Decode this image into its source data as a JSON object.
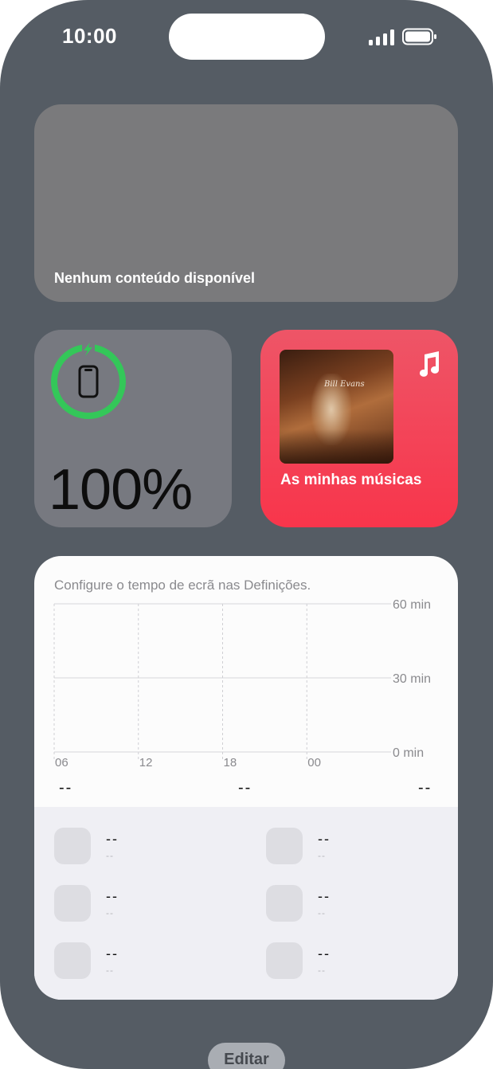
{
  "status_bar": {
    "time": "10:00"
  },
  "news_widget": {
    "message": "Nenhum conteúdo disponível"
  },
  "battery_widget": {
    "level_percent": 100,
    "label": "100%",
    "charging": true,
    "ring_color": "#34c759",
    "device_icon": "iphone-icon",
    "bolt_icon": "lightning-bolt-icon"
  },
  "music_widget": {
    "title": "As minhas músicas",
    "app_icon": "music-note-icon",
    "album_artist": "Bill Evans",
    "accent": "#f8354b"
  },
  "screen_time_widget": {
    "hint": "Configure o tempo de ecrã nas Definições.",
    "summary": [
      "--",
      "--",
      "--"
    ],
    "apps": [
      {
        "name": "--",
        "time": "--"
      },
      {
        "name": "--",
        "time": "--"
      },
      {
        "name": "--",
        "time": "--"
      },
      {
        "name": "--",
        "time": "--"
      },
      {
        "name": "--",
        "time": "--"
      },
      {
        "name": "--",
        "time": "--"
      }
    ]
  },
  "chart_data": {
    "type": "bar",
    "categories": [
      "06",
      "12",
      "18",
      "00"
    ],
    "series": [],
    "ylim": [
      0,
      60
    ],
    "y_ticks": [
      "0 min",
      "30 min",
      "60 min"
    ],
    "x_ticks": [
      "06",
      "12",
      "18",
      "00"
    ],
    "grid": true
  },
  "edit_button": {
    "label": "Editar"
  }
}
